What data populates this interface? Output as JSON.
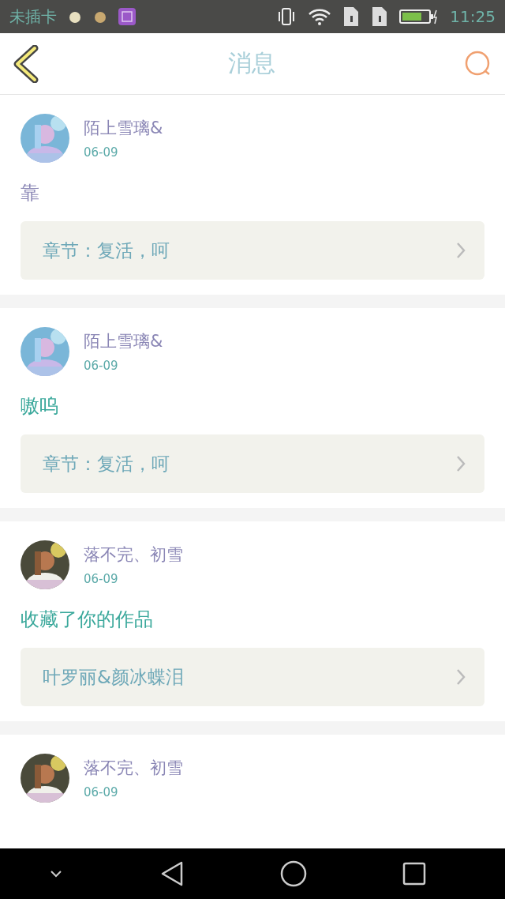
{
  "status_bar": {
    "carrier": "未插卡",
    "time": "11:25"
  },
  "header": {
    "title": "消息"
  },
  "messages": [
    {
      "name": "陌上雪璃&",
      "date": "06-09",
      "text": "靠",
      "link": "章节：复活，呵"
    },
    {
      "name": "陌上雪璃&",
      "date": "06-09",
      "text": "嗷呜",
      "link": "章节：复活，呵"
    },
    {
      "name": "落不完、初雪",
      "date": "06-09",
      "text": "收藏了你的作品",
      "link": "叶罗丽&颜冰蝶泪"
    },
    {
      "name": "落不完、初雪",
      "date": "06-09"
    }
  ]
}
